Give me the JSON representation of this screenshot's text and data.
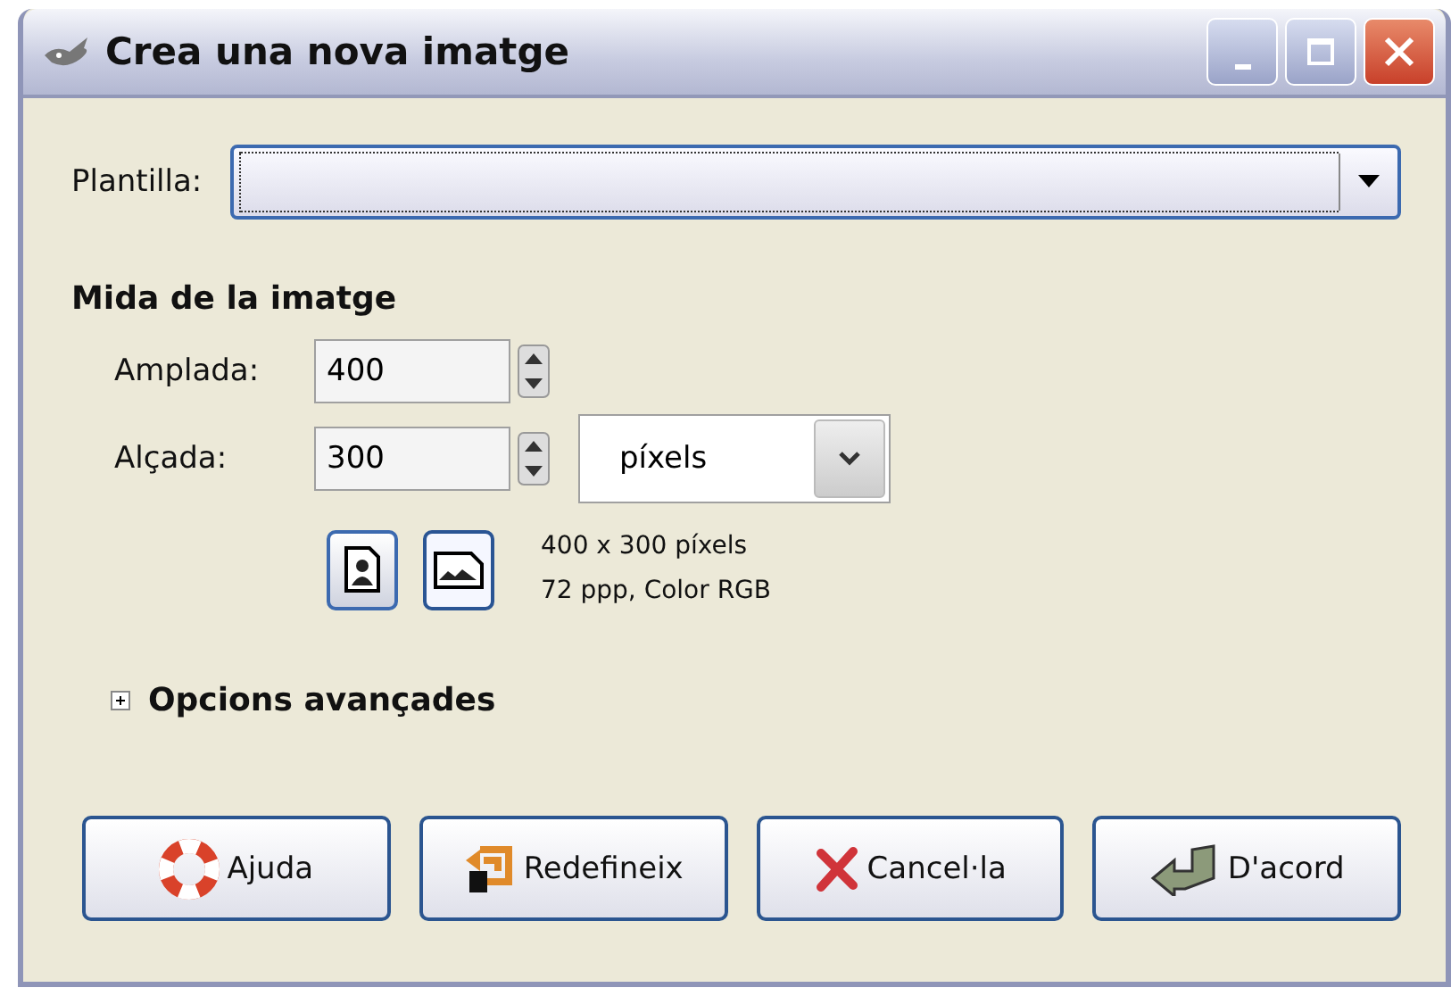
{
  "window": {
    "title": "Crea una nova imatge"
  },
  "template": {
    "label": "Plantilla:"
  },
  "section_title": "Mida de la imatge",
  "width": {
    "label": "Amplada:",
    "value": "400"
  },
  "height": {
    "label": "Alçada:",
    "value": "300"
  },
  "units": {
    "value": "píxels"
  },
  "orientations": [
    {
      "kind": "portrait",
      "selected": false
    },
    {
      "kind": "landscape",
      "selected": true
    }
  ],
  "info": [
    "400 x 300 píxels",
    "72 ppp, Color RGB"
  ],
  "advanced": {
    "label": "Opcions avançades",
    "expanded": false
  },
  "buttons": [
    {
      "kind": "help",
      "label": "Ajuda"
    },
    {
      "kind": "reset",
      "label": "Redefineix"
    },
    {
      "kind": "cancel",
      "label": "Cancel·la"
    },
    {
      "kind": "ok",
      "label": "D'acord"
    }
  ]
}
